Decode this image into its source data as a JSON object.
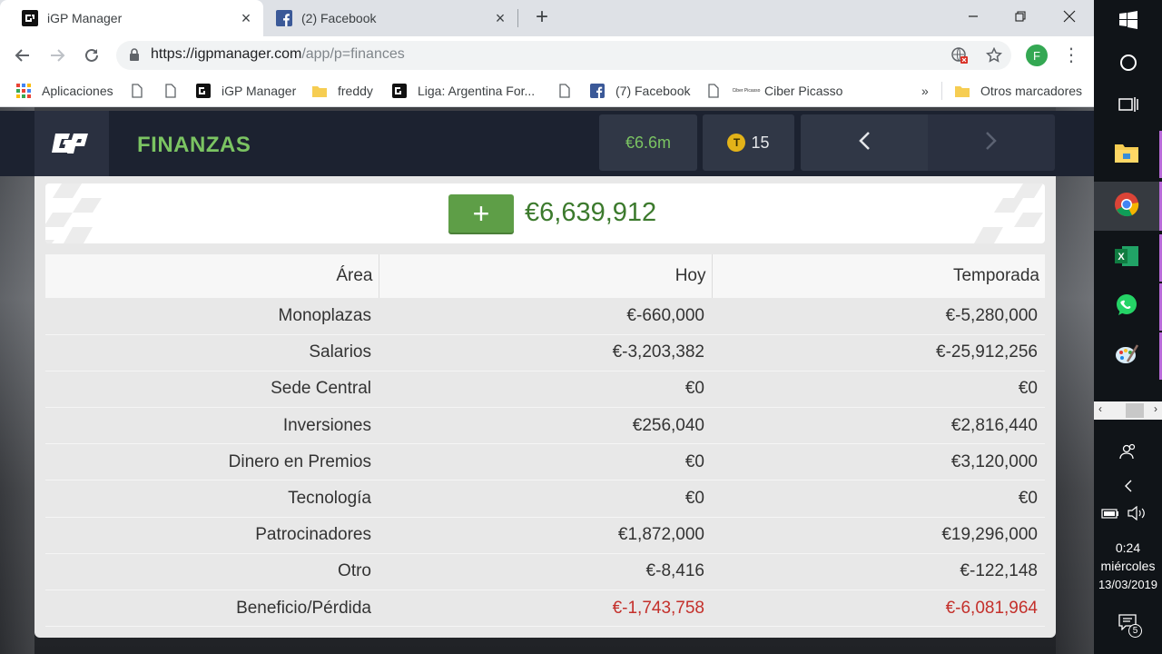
{
  "browser": {
    "tabs": [
      {
        "title": "iGP Manager",
        "active": true
      },
      {
        "title": "(2) Facebook",
        "active": false
      }
    ],
    "url_host": "https://igpmanager.com",
    "url_path": "/app/p=finances",
    "profile_initial": "F",
    "bookmarks": [
      {
        "label": "Aplicaciones",
        "icon": "apps-grid-icon"
      },
      {
        "label": "",
        "icon": "page-icon"
      },
      {
        "label": "",
        "icon": "page-icon"
      },
      {
        "label": "iGP Manager",
        "icon": "igp-icon"
      },
      {
        "label": "freddy",
        "icon": "folder-icon"
      },
      {
        "label": "Liga: Argentina For...",
        "icon": "igp-icon"
      },
      {
        "label": "",
        "icon": "page-icon"
      },
      {
        "label": "(7) Facebook",
        "icon": "facebook-icon"
      },
      {
        "label": "",
        "icon": "page-icon"
      },
      {
        "label": "Ciber Picasso",
        "icon": "ciber-picasso-icon"
      },
      {
        "label": "»",
        "icon": ""
      },
      {
        "label": "Otros marcadores",
        "icon": "folder-icon"
      }
    ],
    "ciber_icon_text": "Ciber Picasso"
  },
  "game": {
    "title": "FINANZAS",
    "money_short": "€6.6m",
    "tokens": "15",
    "balance": "€6,639,912",
    "add_label": "+",
    "accent_color": "#7bc462",
    "table": {
      "headers": [
        "Área",
        "Hoy",
        "Temporada"
      ],
      "rows": [
        {
          "area": "Monoplazas",
          "hoy": "€-660,000",
          "temporada": "€-5,280,000"
        },
        {
          "area": "Salarios",
          "hoy": "€-3,203,382",
          "temporada": "€-25,912,256"
        },
        {
          "area": "Sede Central",
          "hoy": "€0",
          "temporada": "€0"
        },
        {
          "area": "Inversiones",
          "hoy": "€256,040",
          "temporada": "€2,816,440"
        },
        {
          "area": "Dinero en Premios",
          "hoy": "€0",
          "temporada": "€3,120,000"
        },
        {
          "area": "Tecnología",
          "hoy": "€0",
          "temporada": "€0"
        },
        {
          "area": "Patrocinadores",
          "hoy": "€1,872,000",
          "temporada": "€19,296,000"
        },
        {
          "area": "Otro",
          "hoy": "€-8,416",
          "temporada": "€-122,148"
        },
        {
          "area": "Beneficio/Pérdida",
          "hoy": "€-1,743,758",
          "temporada": "€-6,081,964",
          "negative": true
        }
      ]
    }
  },
  "taskbar": {
    "time": "0:24",
    "day": "miércoles",
    "date": "13/03/2019",
    "notifications": "5",
    "excel_icon_text": "X"
  }
}
